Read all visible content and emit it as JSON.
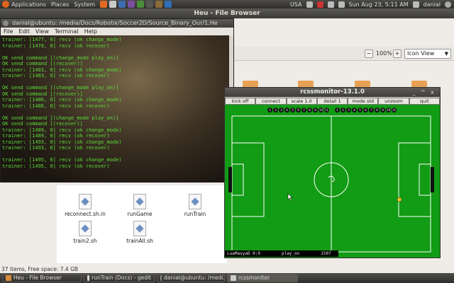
{
  "top_panel": {
    "menus": [
      "Applications",
      "Places",
      "System"
    ],
    "keyboard": "USA",
    "datetime": "Sun Aug 23,  5:11 AM",
    "user": "danial"
  },
  "file_browser": {
    "title": "Heu - File Browser",
    "zoom_out_symbol": "−",
    "zoom_level": "100%",
    "zoom_in_symbol": "+",
    "view_mode": "Icon View",
    "files": [
      {
        "name": "reconnect.sh.in"
      },
      {
        "name": "runGame"
      },
      {
        "name": "runTrain"
      },
      {
        "name": "train2.sh"
      },
      {
        "name": "trainAll.sh"
      }
    ],
    "status": "37 items, Free space: 7.4 GB"
  },
  "terminal": {
    "title": "danial@ubuntu: /media/Docs/Robotix/Soccer2D/Source_Binary_Our/1.He",
    "menu": [
      "File",
      "Edit",
      "View",
      "Terminal",
      "Help"
    ],
    "lines": [
      "trainer: [1477, 0] recv (ok change_mode)",
      "trainer: [1478, 0] recv (ok recover)",
      "",
      "OK send command [(change_mode play_on)]",
      "OK send command [(recover)]",
      "trainer: [1483, 0] recv (ok change_mode)",
      "trainer: [1483, 0] recv (ok recover)",
      "",
      "OK send command [(change_mode play_on)]",
      "OK send command [(recover)]",
      "trainer: [1486, 0] recv (ok change_mode)",
      "trainer: [1486, 0] recv (ok recover)",
      "",
      "OK send command [(change_mode play_on)]",
      "OK send command [(recover)]",
      "trainer: [1489, 0] recv (ok change_mode)",
      "trainer: [1489, 0] recv (ok recover)",
      "trainer: [1493, 0] recv (ok change_mode)",
      "trainer: [1493, 0] recv (ok recover)",
      "",
      "trainer: [1495, 0] recv (ok change_mode)",
      "trainer: [1495, 0] recv (ok recover)"
    ]
  },
  "rcssmonitor": {
    "title": "rcssmonitor-13.1.0",
    "buttons": [
      "kick off",
      "connect",
      "scale 1.0",
      "detail 1",
      "mode std",
      "unzoom",
      "quit"
    ],
    "team_left_players": [
      "1",
      "2",
      "3",
      "4",
      "5",
      "6",
      "7",
      "8",
      "9",
      "10",
      "11"
    ],
    "team_right_players": [
      "1",
      "2",
      "3",
      "4",
      "5",
      "6",
      "7",
      "8",
      "9",
      "10",
      "11"
    ],
    "score_team": "LuaMasyaD 0:0",
    "play_mode": "play_on",
    "cycle": "1507",
    "window_controls": [
      "_",
      "^",
      "x"
    ]
  },
  "taskbar": {
    "items": [
      {
        "label": "Heu - File Browser"
      },
      {
        "label": "runTrain (Docs) - gedit"
      },
      {
        "label": "danial@ubuntu: /medi..."
      },
      {
        "label": "rcssmonitor"
      }
    ]
  },
  "colors": {
    "field": "#129b14",
    "terminal_text": "#5cdc3a",
    "panel": "#3c3b37"
  }
}
